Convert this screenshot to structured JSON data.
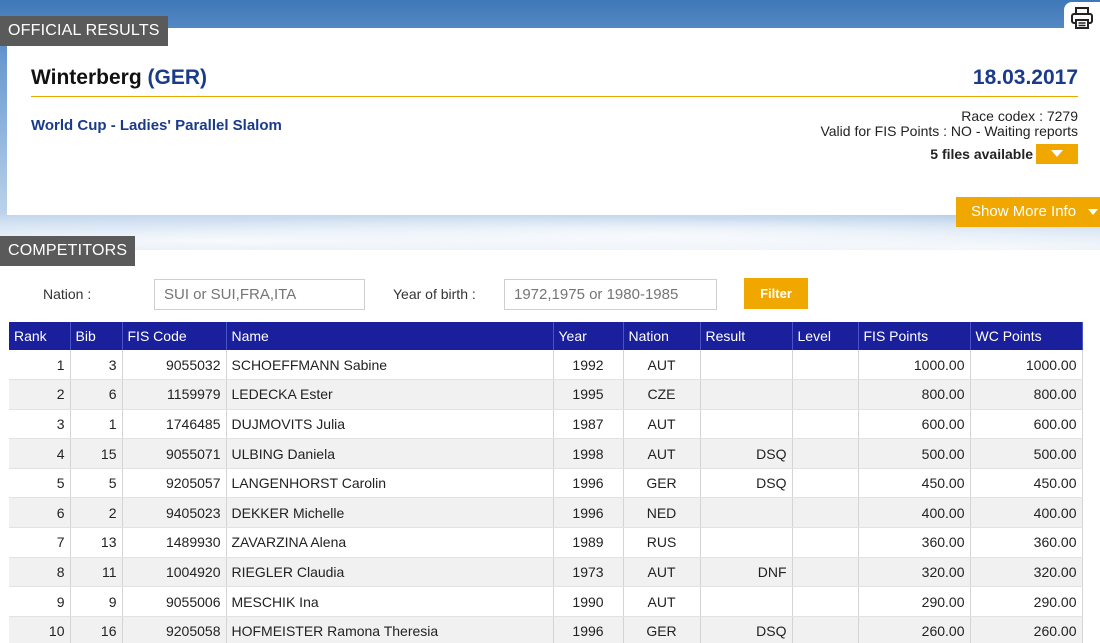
{
  "official_tab": "OFFICIAL RESULTS",
  "header": {
    "location": "Winterberg",
    "nation": "(GER)",
    "date": "18.03.2017",
    "event": "World Cup - Ladies' Parallel Slalom",
    "race_codex": "Race codex : 7279",
    "fis_valid": "Valid for FIS Points : NO - Waiting reports",
    "files": "5 files available",
    "more_info": "Show More Info"
  },
  "competitors_tab": "COMPETITORS",
  "filters": {
    "nation_label": "Nation :",
    "nation_placeholder": "SUI or SUI,FRA,ITA",
    "year_label": "Year of birth :",
    "year_placeholder": "1972,1975 or 1980-1985",
    "filter_button": "Filter"
  },
  "table": {
    "headers": [
      "Rank",
      "Bib",
      "FIS Code",
      "Name",
      "Year",
      "Nation",
      "Result",
      "Level",
      "FIS Points",
      "WC Points"
    ],
    "rows": [
      [
        "1",
        "3",
        "9055032",
        "SCHOEFFMANN Sabine",
        "1992",
        "AUT",
        "",
        "",
        "1000.00",
        "1000.00"
      ],
      [
        "2",
        "6",
        "1159979",
        "LEDECKA Ester",
        "1995",
        "CZE",
        "",
        "",
        "800.00",
        "800.00"
      ],
      [
        "3",
        "1",
        "1746485",
        "DUJMOVITS Julia",
        "1987",
        "AUT",
        "",
        "",
        "600.00",
        "600.00"
      ],
      [
        "4",
        "15",
        "9055071",
        "ULBING Daniela",
        "1998",
        "AUT",
        "DSQ",
        "",
        "500.00",
        "500.00"
      ],
      [
        "5",
        "5",
        "9205057",
        "LANGENHORST Carolin",
        "1996",
        "GER",
        "DSQ",
        "",
        "450.00",
        "450.00"
      ],
      [
        "6",
        "2",
        "9405023",
        "DEKKER Michelle",
        "1996",
        "NED",
        "",
        "",
        "400.00",
        "400.00"
      ],
      [
        "7",
        "13",
        "1489930",
        "ZAVARZINA Alena",
        "1989",
        "RUS",
        "",
        "",
        "360.00",
        "360.00"
      ],
      [
        "8",
        "11",
        "1004920",
        "RIEGLER Claudia",
        "1973",
        "AUT",
        "DNF",
        "",
        "320.00",
        "320.00"
      ],
      [
        "9",
        "9",
        "9055006",
        "MESCHIK Ina",
        "1990",
        "AUT",
        "",
        "",
        "290.00",
        "290.00"
      ],
      [
        "10",
        "16",
        "9205058",
        "HOFMEISTER Ramona Theresia",
        "1996",
        "GER",
        "DSQ",
        "",
        "260.00",
        "260.00"
      ]
    ]
  },
  "colors": {
    "accent": "#f0a800",
    "header_blue": "#1a1f9c",
    "title_blue": "#1a3a8a"
  },
  "icons": {
    "print": "printer-icon",
    "dropdown": "caret-down-icon"
  }
}
